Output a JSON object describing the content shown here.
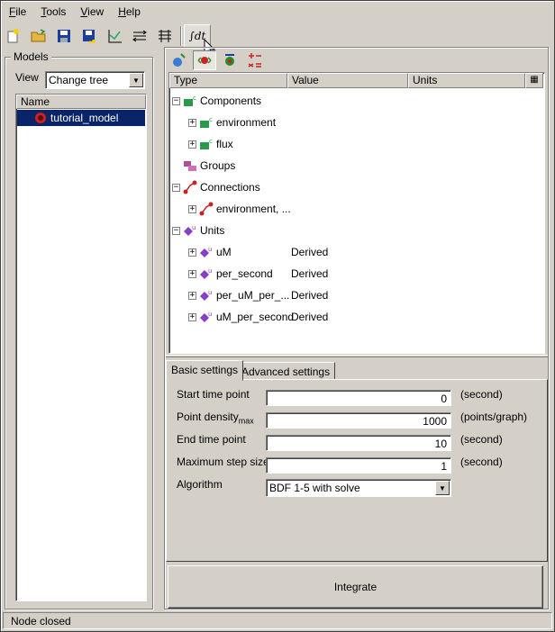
{
  "menu": [
    {
      "label_first": "F",
      "label_rest": "ile"
    },
    {
      "label_first": "T",
      "label_rest": "ools"
    },
    {
      "label_first": "V",
      "label_rest": "iew"
    },
    {
      "label_first": "H",
      "label_rest": "elp"
    }
  ],
  "toolbar": {
    "icons": [
      "new-file-icon",
      "open-folder-icon",
      "save-icon",
      "save-all-icon",
      "graph-icon",
      "arrows-icon",
      "arrows-alt-icon"
    ],
    "integrator_symbol": "∫dt"
  },
  "models": {
    "group_title": "Models",
    "view_label": "View",
    "view_value": "Change tree",
    "list_header": "Name",
    "selected_item": "tutorial_model"
  },
  "tree": {
    "columns": [
      "Type",
      "Value",
      "Units"
    ],
    "rows": {
      "components": "Components",
      "environment": "environment",
      "flux": "flux",
      "groups": "Groups",
      "connections": "Connections",
      "connection_env": "environment, ...",
      "units": "Units",
      "uM": "uM",
      "uM_value": "Derived",
      "per_second": "per_second",
      "per_second_value": "Derived",
      "per_uM_per": "per_uM_per_...",
      "per_uM_per_value": "Derived",
      "uM_per_second": "uM_per_second",
      "uM_per_second_value": "Derived"
    }
  },
  "tabs": {
    "basic": "Basic settings",
    "advanced": "Advanced settings"
  },
  "settings": {
    "start_time": {
      "label": "Start time point",
      "value": "0",
      "unit": "(second)"
    },
    "point_density": {
      "label": "Point density",
      "label_sub": "max",
      "value": "1000",
      "unit": "(points/graph)"
    },
    "end_time": {
      "label": "End time point",
      "value": "10",
      "unit": "(second)"
    },
    "max_step": {
      "label": "Maximum step size",
      "value": "1",
      "unit": "(second)"
    },
    "algorithm": {
      "label": "Algorithm",
      "value": "BDF 1-5 with solve"
    }
  },
  "integrate_label": "Integrate",
  "status_text": "Node closed"
}
